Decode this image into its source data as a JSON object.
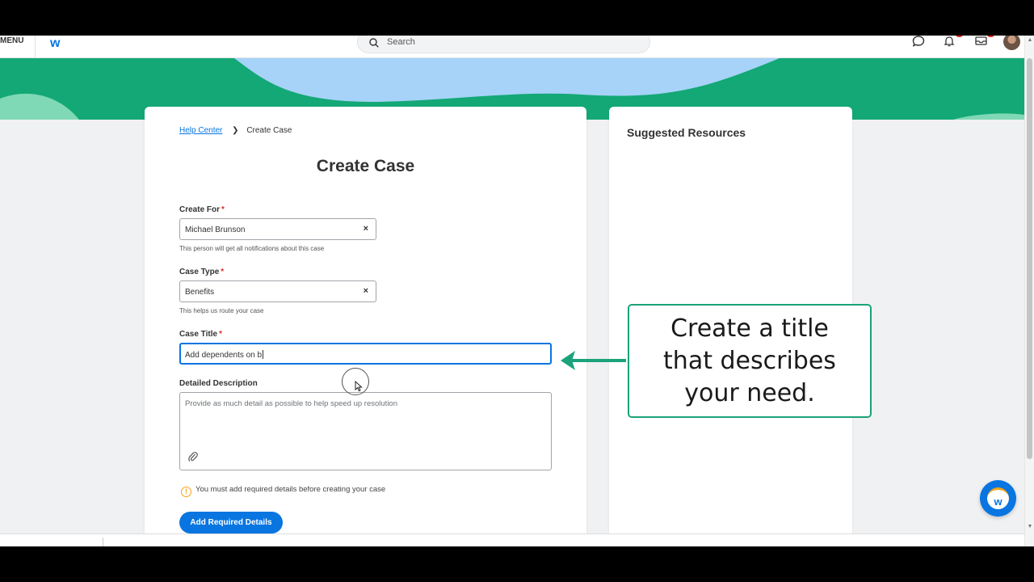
{
  "topbar": {
    "menu_label": "MENU",
    "logo_text": "w",
    "search_placeholder": "Search"
  },
  "breadcrumb": {
    "parent": "Help Center",
    "current": "Create Case"
  },
  "page_title": "Create Case",
  "form": {
    "create_for": {
      "label": "Create For",
      "required_mark": "*",
      "value": "Michael Brunson",
      "clear_icon": "×",
      "hint": "This person will get all notifications about this case"
    },
    "case_type": {
      "label": "Case Type",
      "required_mark": "*",
      "value": "Benefits",
      "clear_icon": "×",
      "hint": "This helps us route your case"
    },
    "case_title": {
      "label": "Case Title",
      "required_mark": "*",
      "value": "Add dependents on b"
    },
    "description": {
      "label": "Detailed Description",
      "placeholder": "Provide as much detail as possible to help speed up resolution"
    },
    "warning_icon": "!",
    "warning": "You must add required details before creating your case",
    "submit_label": "Add Required Details"
  },
  "side_panel": {
    "title": "Suggested Resources"
  },
  "callout": {
    "text": "Create a title that describes your need."
  },
  "chat_fab": {
    "label": "w"
  },
  "colors": {
    "brand_blue": "#0875e1",
    "banner_green": "#13a875",
    "callout_border": "#1aa37a",
    "required_red": "#de2e21",
    "warning_orange": "#f0a418"
  },
  "icons": [
    "search-icon",
    "chat-bubble-icon",
    "bell-icon",
    "inbox-icon",
    "close-icon",
    "paperclip-icon",
    "warning-icon",
    "arrow-left-icon"
  ]
}
